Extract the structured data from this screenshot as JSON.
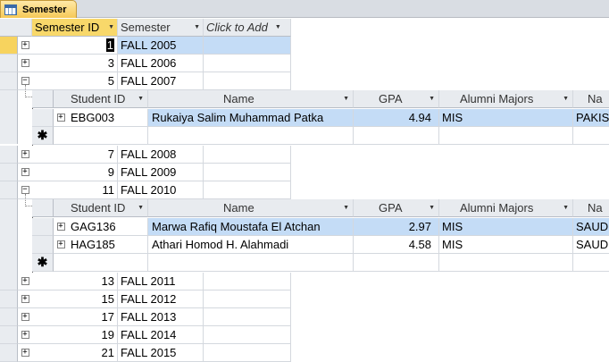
{
  "tab": {
    "title": "Semester",
    "icon": "table-icon"
  },
  "columns": {
    "semester_id": "Semester ID",
    "semester": "Semester",
    "add": "Click to Add"
  },
  "sub_columns": {
    "student_id": "Student ID",
    "name": "Name",
    "gpa": "GPA",
    "majors": "Alumni Majors",
    "nat": "Na"
  },
  "rows": [
    {
      "id": "1",
      "semester": "FALL 2005"
    },
    {
      "id": "3",
      "semester": "FALL 2006"
    },
    {
      "id": "5",
      "semester": "FALL 2007"
    },
    {
      "id": "7",
      "semester": "FALL 2008"
    },
    {
      "id": "9",
      "semester": "FALL 2009"
    },
    {
      "id": "11",
      "semester": "FALL 2010"
    },
    {
      "id": "13",
      "semester": "FALL 2011"
    },
    {
      "id": "15",
      "semester": "FALL 2012"
    },
    {
      "id": "17",
      "semester": "FALL 2013"
    },
    {
      "id": "19",
      "semester": "FALL 2014"
    },
    {
      "id": "21",
      "semester": "FALL 2015"
    }
  ],
  "sub1": [
    {
      "student_id": "EBG003",
      "name": "Rukaiya Salim Muhammad Patka",
      "gpa": "4.94",
      "majors": "MIS",
      "nat": "PAKIST"
    }
  ],
  "sub2": [
    {
      "student_id": "GAG136",
      "name": "Marwa Rafiq Moustafa El Atchan",
      "gpa": "2.97",
      "majors": "MIS",
      "nat": "SAUDI"
    },
    {
      "student_id": "HAG185",
      "name": "Athari Homod H. Alahmadi",
      "gpa": "4.58",
      "majors": "MIS",
      "nat": "SAUDI"
    }
  ],
  "symbols": {
    "plus": "+",
    "minus": "−",
    "new": "✱"
  }
}
